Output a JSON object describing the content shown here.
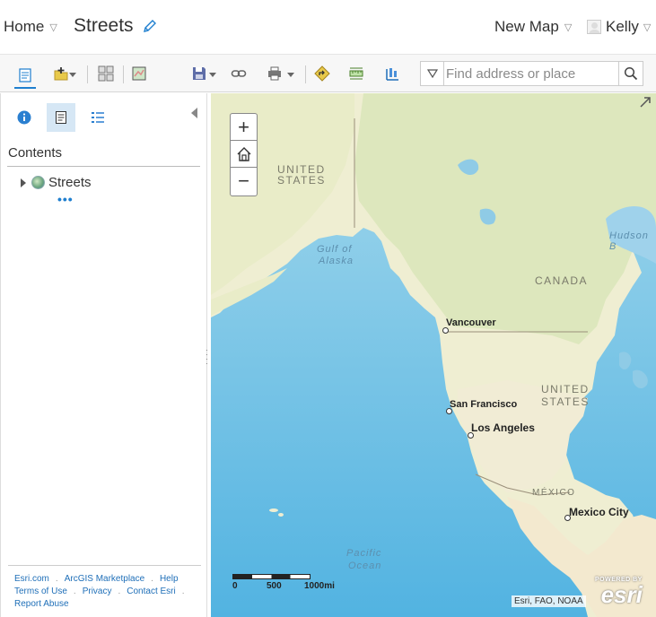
{
  "header": {
    "home_label": "Home",
    "map_title": "Streets",
    "new_map_label": "New Map",
    "user_name": "Kelly"
  },
  "toolbar": {
    "items": [
      "details-icon",
      "add-icon",
      "basemap-icon",
      "analysis-icon",
      "save-icon",
      "share-link-icon",
      "print-icon",
      "directions-icon",
      "measure-icon",
      "bookmarks-icon"
    ]
  },
  "search": {
    "placeholder": "Find address or place"
  },
  "sidebar": {
    "contents_heading": "Contents",
    "layer_name": "Streets",
    "more_dots": "•••",
    "footer": {
      "row1": [
        "Esri.com",
        "ArcGIS Marketplace",
        "Help"
      ],
      "row2": [
        "Terms of Use",
        "Privacy",
        "Contact Esri"
      ],
      "row3": [
        "Report Abuse"
      ]
    }
  },
  "map": {
    "labels": {
      "us_top_1": "UNITED",
      "us_top_2": "STATES",
      "gulf_1": "Gulf of",
      "gulf_2": "Alaska",
      "hudson": "Hudson B",
      "canada": "CANADA",
      "us_1": "UNITED",
      "us_2": "STATES",
      "mexico": "MÉXICO",
      "pacific_1": "Pacific",
      "pacific_2": "Ocean"
    },
    "cities": {
      "vancouver": "Vancouver",
      "san_francisco": "San Francisco",
      "los_angeles": "Los Angeles",
      "mexico_city": "Mexico City"
    },
    "zoom_in": "+",
    "zoom_out": "−",
    "scale": {
      "s0": "0",
      "s1": "500",
      "s2": "1000mi"
    },
    "attribution": "Esri, FAO, NOAA",
    "esri_powered": "POWERED BY",
    "esri_logo": "esri"
  }
}
